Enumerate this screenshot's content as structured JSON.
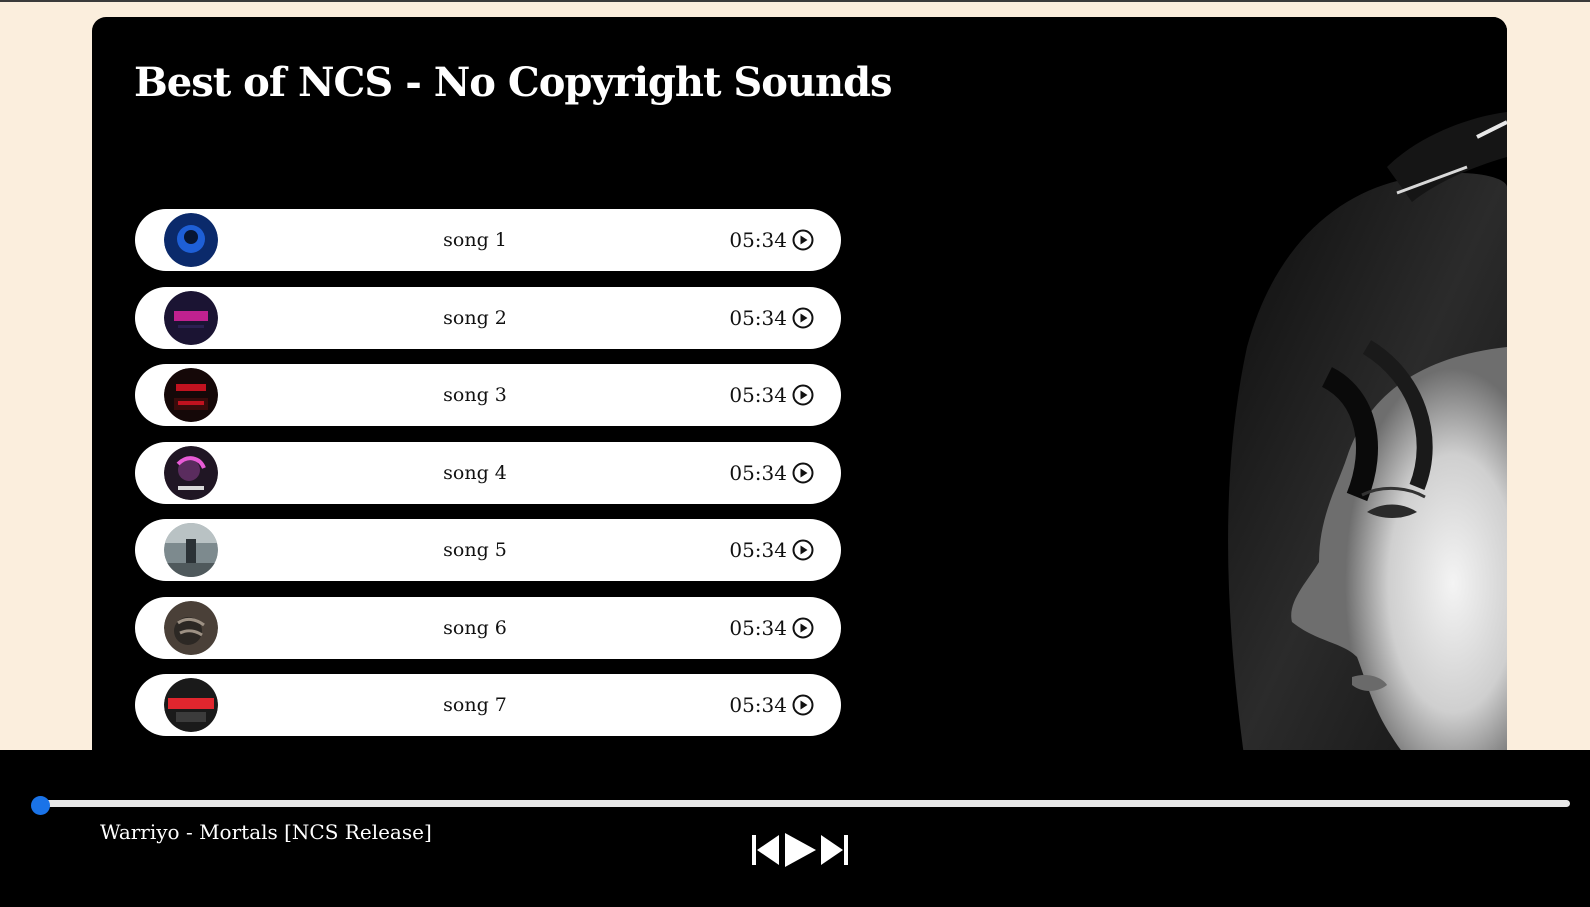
{
  "playlist": {
    "title": "Best of NCS - No Copyright Sounds"
  },
  "songs": [
    {
      "name": "song 1",
      "duration": "05:34",
      "cover_colors": [
        "#0b2a6b",
        "#1e5fd6",
        "#071633"
      ]
    },
    {
      "name": "song 2",
      "duration": "05:34",
      "cover_colors": [
        "#1b1433",
        "#c0218f",
        "#2a2050"
      ]
    },
    {
      "name": "song 3",
      "duration": "05:34",
      "cover_colors": [
        "#150808",
        "#c1121f",
        "#3a0b0b"
      ]
    },
    {
      "name": "song 4",
      "duration": "05:34",
      "cover_colors": [
        "#201624",
        "#e85bd6",
        "#5a2c5e"
      ]
    },
    {
      "name": "song 5",
      "duration": "05:34",
      "cover_colors": [
        "#7d8a8e",
        "#2b3236",
        "#b9c2c4"
      ]
    },
    {
      "name": "song 6",
      "duration": "05:34",
      "cover_colors": [
        "#4a4038",
        "#9d9184",
        "#2c2824"
      ]
    },
    {
      "name": "song 7",
      "duration": "05:34",
      "cover_colors": [
        "#1a1a1a",
        "#e0262e",
        "#3b3b3b"
      ]
    }
  ],
  "player": {
    "now_playing": "Warriyo - Mortals [NCS Release]",
    "progress": 0.0,
    "accent_color": "#1a73e8"
  },
  "icons": {
    "play": "circle-play-icon",
    "previous": "skip-previous-icon",
    "play_main": "play-icon",
    "next": "skip-next-icon"
  }
}
